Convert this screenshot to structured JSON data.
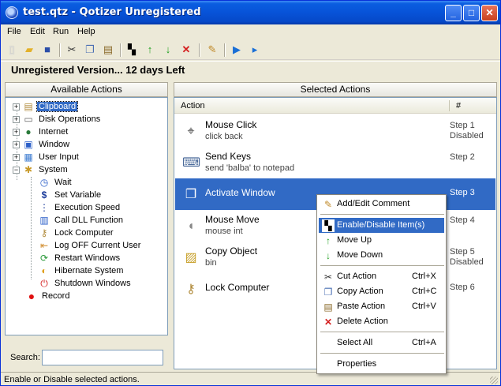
{
  "window": {
    "title": "test.qtz - Qotizer Unregistered"
  },
  "menu": [
    "File",
    "Edit",
    "Run",
    "Help"
  ],
  "toolbar_icons": [
    "new-icon",
    "open-icon",
    "save-icon",
    "cut-icon",
    "copy-icon",
    "paste-icon",
    "enable-disable-icon",
    "move-up-icon",
    "move-down-icon",
    "delete-icon",
    "comment-icon",
    "play-icon",
    "play-step-icon"
  ],
  "banner": "Unregistered Version... 12 days Left",
  "left_panel": {
    "header": "Available Actions",
    "tree": [
      {
        "label": "Clipboard",
        "icon": "clipboard-icon"
      },
      {
        "label": "Disk Operations",
        "icon": "disk-icon"
      },
      {
        "label": "Internet",
        "icon": "globe-icon"
      },
      {
        "label": "Window",
        "icon": "window-icon"
      },
      {
        "label": "User Input",
        "icon": "user-input-icon"
      },
      {
        "label": "System",
        "icon": "system-icon"
      },
      {
        "label": "Wait",
        "icon": "stopwatch-icon"
      },
      {
        "label": "Set Variable",
        "icon": "variable-icon"
      },
      {
        "label": "Execution Speed",
        "icon": "speed-icon"
      },
      {
        "label": "Call DLL Function",
        "icon": "dll-icon"
      },
      {
        "label": "Lock Computer",
        "icon": "keys-icon"
      },
      {
        "label": "Log OFF Current User",
        "icon": "logoff-icon"
      },
      {
        "label": "Restart Windows",
        "icon": "restart-icon"
      },
      {
        "label": "Hibernate System",
        "icon": "hibernate-icon"
      },
      {
        "label": "Shutdown Windows",
        "icon": "shutdown-icon"
      },
      {
        "label": "Record",
        "icon": "record-icon"
      }
    ],
    "search_label": "Search:",
    "search_value": ""
  },
  "right_panel": {
    "header": "Selected Actions",
    "col_action": "Action",
    "col_num": "#",
    "rows": [
      {
        "title": "Mouse Click",
        "desc": "click back",
        "step": "Step 1",
        "status": "Disabled",
        "icon": "mouse-click-icon"
      },
      {
        "title": "Send Keys",
        "desc": "send 'balba' to notepad",
        "step": "Step 2",
        "status": "",
        "icon": "keyboard-icon"
      },
      {
        "title": "Activate Window",
        "desc": "",
        "step": "Step 3",
        "status": "",
        "icon": "activate-window-icon"
      },
      {
        "title": "Mouse Move",
        "desc": "mouse int",
        "step": "Step 4",
        "status": "",
        "icon": "mouse-icon"
      },
      {
        "title": "Copy Object",
        "desc": "bin",
        "step": "Step 5",
        "status": "Disabled",
        "icon": "copy-object-icon"
      },
      {
        "title": "Lock Computer",
        "desc": "",
        "step": "Step 6",
        "status": "",
        "icon": "keys-icon"
      }
    ]
  },
  "context_menu": {
    "items": [
      {
        "label": "Add/Edit Comment",
        "shortcut": "",
        "icon": "comment-icon"
      },
      {
        "label": "Enable/Disable Item(s)",
        "shortcut": "",
        "icon": "enable-disable-icon"
      },
      {
        "label": "Move Up",
        "shortcut": "",
        "icon": "up-arrow-icon"
      },
      {
        "label": "Move Down",
        "shortcut": "",
        "icon": "down-arrow-icon"
      },
      {
        "label": "Cut Action",
        "shortcut": "Ctrl+X",
        "icon": "cut-icon"
      },
      {
        "label": "Copy Action",
        "shortcut": "Ctrl+C",
        "icon": "copy-icon"
      },
      {
        "label": "Paste Action",
        "shortcut": "Ctrl+V",
        "icon": "paste-icon"
      },
      {
        "label": "Delete Action",
        "shortcut": "",
        "icon": "delete-icon"
      },
      {
        "label": "Select All",
        "shortcut": "Ctrl+A",
        "icon": ""
      },
      {
        "label": "Properties",
        "shortcut": "",
        "icon": ""
      }
    ]
  },
  "status_text": "Enable or Disable selected actions."
}
